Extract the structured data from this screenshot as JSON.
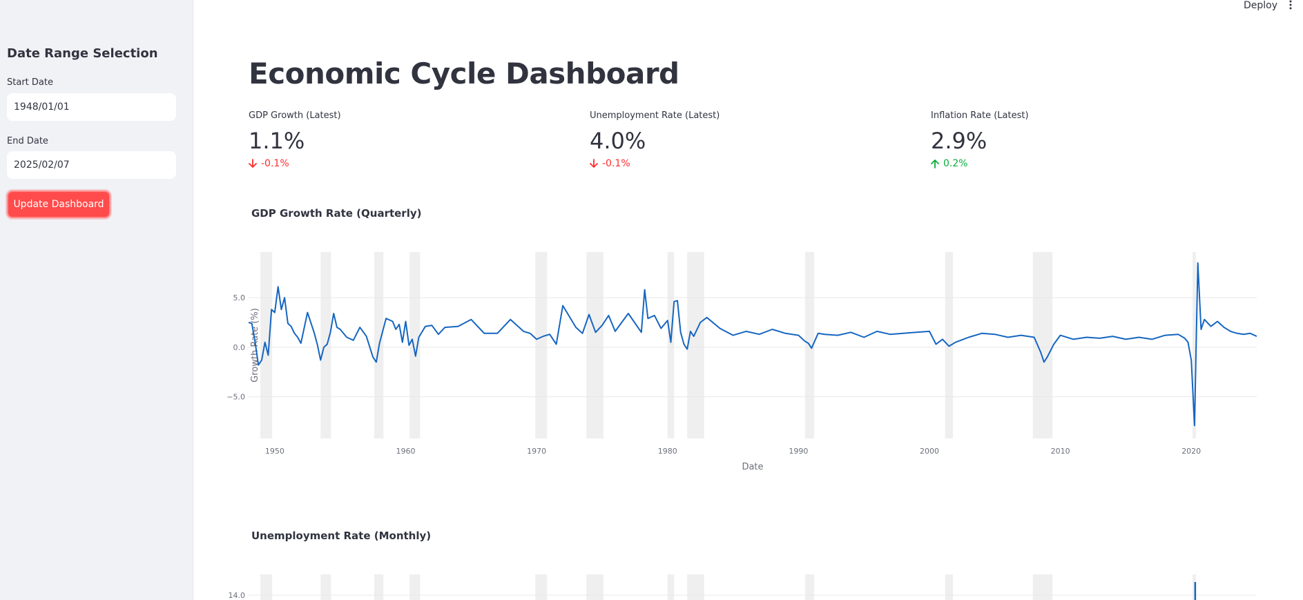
{
  "header": {
    "deploy_label": "Deploy"
  },
  "sidebar": {
    "heading": "Date Range Selection",
    "start_label": "Start Date",
    "start_value": "1948/01/01",
    "end_label": "End Date",
    "end_value": "2025/02/07",
    "button_label": "Update Dashboard"
  },
  "main": {
    "title": "Economic Cycle Dashboard",
    "metrics": [
      {
        "label": "GDP Growth (Latest)",
        "value": "1.1%",
        "delta": "-0.1%",
        "direction": "down"
      },
      {
        "label": "Unemployment Rate (Latest)",
        "value": "4.0%",
        "delta": "-0.1%",
        "direction": "down"
      },
      {
        "label": "Inflation Rate (Latest)",
        "value": "2.9%",
        "delta": "0.2%",
        "direction": "up"
      }
    ],
    "gdp_section_title": "GDP Growth Rate (Quarterly)",
    "unemp_section_title": "Unemployment Rate (Monthly)"
  },
  "colors": {
    "line": "#1565c0",
    "recession_band": "#efefef",
    "accent": "#ff4b4b",
    "delta_down": "#ff2b2b",
    "delta_up": "#09ab3b"
  },
  "chart_data": [
    {
      "type": "line",
      "title": "GDP Growth Rate (Quarterly)",
      "xlabel": "Date",
      "ylabel": "Growth Rate (%)",
      "xlim": [
        1948.0,
        2025.0
      ],
      "ylim": [
        -9.2,
        9.6
      ],
      "x_ticks": [
        1950,
        1960,
        1970,
        1980,
        1990,
        2000,
        2010,
        2020
      ],
      "y_ticks": [
        5,
        0,
        -5
      ],
      "y_tick_labels": [
        "5.0",
        "0.0",
        "−5.0"
      ],
      "grid": true,
      "recessions": [
        [
          1948.9,
          1949.8
        ],
        [
          1953.5,
          1954.3
        ],
        [
          1957.6,
          1958.3
        ],
        [
          1960.3,
          1961.1
        ],
        [
          1969.9,
          1970.8
        ],
        [
          1973.8,
          1975.1
        ],
        [
          1980.0,
          1980.5
        ],
        [
          1981.5,
          1982.8
        ],
        [
          1990.5,
          1991.2
        ],
        [
          2001.2,
          2001.8
        ],
        [
          2007.9,
          2009.4
        ],
        [
          2020.1,
          2020.3
        ]
      ],
      "series": [
        {
          "x": [
            1948.0,
            1948.25,
            1948.5,
            1948.75,
            1949.0,
            1949.25,
            1949.5,
            1949.75,
            1950.0,
            1950.25,
            1950.5,
            1950.75,
            1951.0,
            1951.25,
            1951.5,
            1951.75,
            1952.0,
            1952.5,
            1953.0,
            1953.25,
            1953.5,
            1953.75,
            1954.0,
            1954.25,
            1954.5,
            1954.75,
            1955.0,
            1955.5,
            1956.0,
            1956.5,
            1957.0,
            1957.5,
            1957.75,
            1958.0,
            1958.5,
            1959.0,
            1959.25,
            1959.5,
            1959.75,
            1960.0,
            1960.25,
            1960.5,
            1960.75,
            1961.0,
            1961.5,
            1962.0,
            1962.5,
            1963.0,
            1964.0,
            1965.0,
            1966.0,
            1967.0,
            1968.0,
            1969.0,
            1969.5,
            1970.0,
            1970.5,
            1971.0,
            1971.5,
            1972.0,
            1973.0,
            1973.5,
            1974.0,
            1974.5,
            1975.0,
            1975.5,
            1976.0,
            1977.0,
            1978.0,
            1978.25,
            1978.5,
            1979.0,
            1979.5,
            1980.0,
            1980.25,
            1980.5,
            1980.75,
            1981.0,
            1981.25,
            1981.5,
            1981.75,
            1982.0,
            1982.5,
            1983.0,
            1984.0,
            1985.0,
            1986.0,
            1987.0,
            1988.0,
            1989.0,
            1990.0,
            1990.5,
            1990.75,
            1991.0,
            1991.5,
            1992.0,
            1993.0,
            1994.0,
            1995.0,
            1996.0,
            1997.0,
            1998.0,
            1999.0,
            2000.0,
            2000.5,
            2001.0,
            2001.5,
            2002.0,
            2003.0,
            2004.0,
            2005.0,
            2006.0,
            2007.0,
            2008.0,
            2008.5,
            2008.75,
            2009.0,
            2009.5,
            2010.0,
            2011.0,
            2012.0,
            2013.0,
            2014.0,
            2015.0,
            2016.0,
            2017.0,
            2018.0,
            2019.0,
            2019.5,
            2019.75,
            2020.0,
            2020.25,
            2020.5,
            2020.75,
            2021.0,
            2021.5,
            2022.0,
            2022.5,
            2023.0,
            2023.5,
            2024.0,
            2024.5,
            2025.0
          ],
          "y": [
            2.5,
            2.4,
            0.5,
            -1.8,
            -1.3,
            0.5,
            -0.8,
            3.8,
            3.5,
            6.1,
            3.8,
            5.0,
            2.4,
            2.1,
            1.4,
            1.0,
            0.4,
            3.5,
            1.5,
            0.3,
            -1.3,
            0.0,
            0.3,
            1.5,
            3.4,
            2.0,
            1.8,
            1.0,
            0.7,
            2.0,
            1.1,
            -1.0,
            -1.5,
            0.4,
            2.9,
            2.6,
            1.8,
            2.3,
            0.5,
            2.6,
            0.2,
            0.8,
            -0.9,
            1.0,
            2.1,
            2.2,
            1.3,
            2.0,
            2.1,
            2.8,
            1.4,
            1.4,
            2.8,
            1.6,
            1.4,
            0.8,
            1.1,
            1.3,
            0.3,
            4.2,
            2.0,
            1.4,
            3.3,
            1.5,
            2.2,
            3.2,
            1.6,
            3.4,
            1.5,
            5.8,
            2.9,
            3.2,
            1.9,
            2.7,
            0.5,
            4.6,
            4.7,
            1.5,
            0.3,
            -0.2,
            1.6,
            1.1,
            2.5,
            3.0,
            1.9,
            1.2,
            1.6,
            1.3,
            1.8,
            1.4,
            1.2,
            0.6,
            0.4,
            -0.1,
            1.4,
            1.3,
            1.2,
            1.5,
            1.0,
            1.6,
            1.3,
            1.4,
            1.5,
            1.6,
            0.3,
            0.8,
            0.1,
            0.5,
            1.0,
            1.4,
            1.3,
            1.0,
            1.2,
            1.0,
            -0.5,
            -1.5,
            -1.0,
            0.3,
            1.2,
            0.8,
            1.0,
            0.9,
            1.1,
            0.8,
            1.0,
            0.8,
            1.2,
            1.3,
            0.9,
            0.5,
            -1.3,
            -7.9,
            8.5,
            1.8,
            2.8,
            2.1,
            2.6,
            2.0,
            1.6,
            1.4,
            1.3,
            1.4,
            1.1
          ]
        }
      ]
    },
    {
      "type": "line",
      "title": "Unemployment Rate (Monthly)",
      "xlim": [
        1948.0,
        2025.0
      ],
      "y_ticks": [
        14
      ],
      "y_tick_labels": [
        "14.0"
      ],
      "grid": true
    }
  ]
}
